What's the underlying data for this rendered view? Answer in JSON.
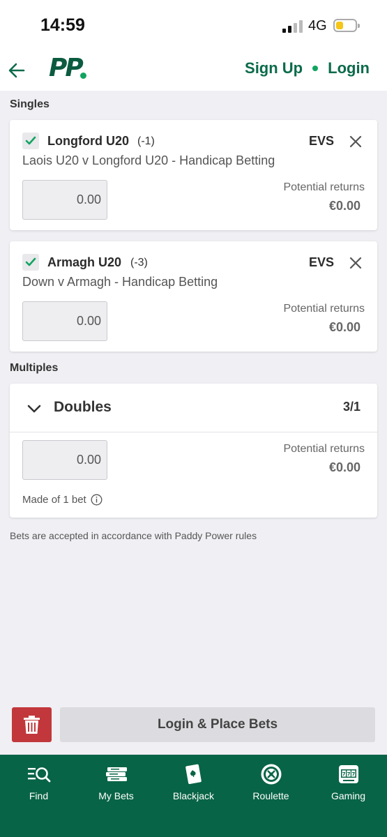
{
  "status_bar": {
    "time": "14:59",
    "network": "4G"
  },
  "header": {
    "logo": "PP",
    "sign_up": "Sign Up",
    "login": "Login"
  },
  "singles": {
    "label": "Singles",
    "bets": [
      {
        "selection": "Longford U20",
        "line": "(-1)",
        "odds": "EVS",
        "market": "Laois U20 v Longford U20 - Handicap Betting",
        "stake_value": "0.00",
        "returns_label": "Potential returns",
        "returns_value": "€0.00"
      },
      {
        "selection": "Armagh U20",
        "line": "(-3)",
        "odds": "EVS",
        "market": "Down v Armagh - Handicap Betting",
        "stake_value": "0.00",
        "returns_label": "Potential returns",
        "returns_value": "€0.00"
      }
    ]
  },
  "multiples": {
    "label": "Multiples",
    "doubles": {
      "title": "Doubles",
      "odds": "3/1",
      "stake_value": "0.00",
      "returns_label": "Potential returns",
      "returns_value": "€0.00",
      "made_of": "Made of 1 bet"
    }
  },
  "rules_note": "Bets are accepted in accordance with Paddy Power rules",
  "actions": {
    "place_bets": "Login & Place Bets"
  },
  "bottom_nav": [
    {
      "label": "Find",
      "icon": "search-list-icon"
    },
    {
      "label": "My Bets",
      "icon": "bet-slips-icon"
    },
    {
      "label": "Blackjack",
      "icon": "playing-card-icon"
    },
    {
      "label": "Roulette",
      "icon": "roulette-wheel-icon"
    },
    {
      "label": "Gaming",
      "icon": "slot-machine-icon"
    }
  ],
  "colors": {
    "brand_green": "#0b6b4b",
    "nav_green": "#086446",
    "accent_green": "#11a460",
    "trash_red": "#c1373b",
    "background": "#f0eff4"
  }
}
